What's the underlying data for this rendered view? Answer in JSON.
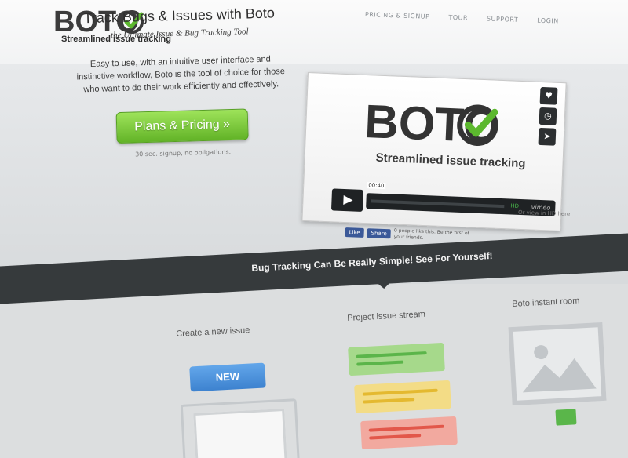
{
  "header": {
    "logo_text": "BOTO",
    "tagline": "Streamlined issue tracking",
    "nav": [
      "PRICING & SIGNUP",
      "TOUR",
      "SUPPORT",
      "LOGIN"
    ]
  },
  "hero": {
    "title": "Track Bugs & Issues with Boto",
    "subtitle": "the Ultimate Issue & Bug Tracking Tool",
    "description": "Easy to use, with an intuitive user interface and instinctive workflow, Boto is the tool of choice for those who want to do their work efficiently and effectively.",
    "cta_label": "Plans & Pricing  »",
    "cta_note": "30 sec. signup, no obligations."
  },
  "video": {
    "logo_text": "BOTO",
    "tagline": "Streamlined issue tracking",
    "time": "00:40",
    "hd_label": "HD",
    "provider": "vimeo"
  },
  "social": {
    "like_label": "Like",
    "share_label": "Share",
    "note": "0 people like this. Be the first of your friends."
  },
  "hd_link": "Or view in HD here",
  "band": {
    "text": "Bug Tracking Can Be Really Simple! See For Yourself!"
  },
  "features": {
    "create_title": "Create a new issue",
    "new_button": "NEW",
    "stream_title": "Project issue stream",
    "instant_title": "Boto instant room"
  },
  "colors": {
    "accent_green": "#62b327",
    "accent_blue": "#3d82cf",
    "band": "#363a3c"
  }
}
